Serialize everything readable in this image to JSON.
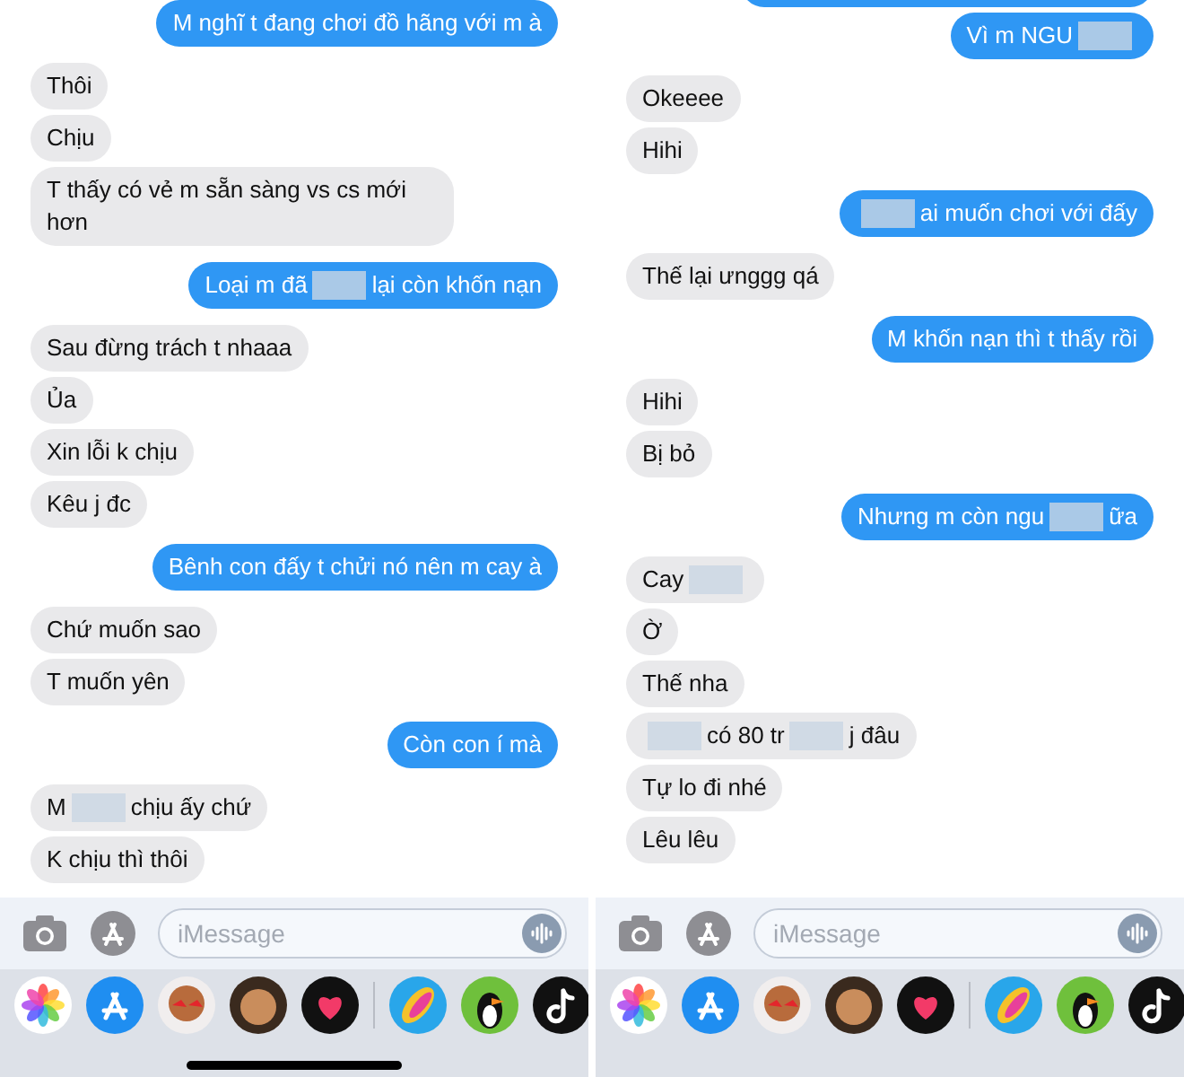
{
  "panels": [
    {
      "messages": [
        {
          "sent": true,
          "kind": "text",
          "parts": [
            {
              "kind": "text",
              "text": "M nghĩ t đang chơi đồ hãng với m à"
            }
          ]
        },
        {
          "sent": false,
          "kind": "text",
          "parts": [
            {
              "kind": "text",
              "text": "Thôi"
            }
          ]
        },
        {
          "sent": false,
          "kind": "text",
          "parts": [
            {
              "kind": "text",
              "text": "Chịu"
            }
          ]
        },
        {
          "sent": false,
          "kind": "text",
          "parts": [
            {
              "kind": "text",
              "text": "T thấy có vẻ m sẵn sàng vs cs mới hơn"
            }
          ]
        },
        {
          "sent": true,
          "kind": "text",
          "parts": [
            {
              "kind": "text",
              "text": "Loại m đã"
            },
            {
              "kind": "blur"
            },
            {
              "kind": "text",
              "text": "lại còn khốn nạn"
            }
          ]
        },
        {
          "sent": false,
          "kind": "text",
          "parts": [
            {
              "kind": "text",
              "text": "Sau đừng trách t nhaaa"
            }
          ]
        },
        {
          "sent": false,
          "kind": "text",
          "parts": [
            {
              "kind": "text",
              "text": "Ủa"
            }
          ]
        },
        {
          "sent": false,
          "kind": "text",
          "parts": [
            {
              "kind": "text",
              "text": "Xin lỗi k chịu"
            }
          ]
        },
        {
          "sent": false,
          "kind": "text",
          "parts": [
            {
              "kind": "text",
              "text": "Kêu j đc"
            }
          ]
        },
        {
          "sent": true,
          "kind": "text",
          "parts": [
            {
              "kind": "text",
              "text": "Bênh con đấy t chửi nó nên m cay à"
            }
          ]
        },
        {
          "sent": false,
          "kind": "text",
          "parts": [
            {
              "kind": "text",
              "text": "Chứ muốn sao"
            }
          ]
        },
        {
          "sent": false,
          "kind": "text",
          "parts": [
            {
              "kind": "text",
              "text": "T muốn yên"
            }
          ]
        },
        {
          "sent": true,
          "kind": "text",
          "parts": [
            {
              "kind": "text",
              "text": "Còn con í mà"
            }
          ]
        },
        {
          "sent": false,
          "kind": "text",
          "parts": [
            {
              "kind": "text",
              "text": "M"
            },
            {
              "kind": "blur"
            },
            {
              "kind": "text",
              "text": "chịu ấy chứ"
            }
          ]
        },
        {
          "sent": false,
          "kind": "text",
          "parts": [
            {
              "kind": "text",
              "text": "K chịu thì thôi"
            }
          ]
        }
      ],
      "input": {
        "placeholder": "iMessage"
      },
      "home_indicator": true
    },
    {
      "messages": [
        {
          "sent": true,
          "kind": "covered"
        },
        {
          "sent": true,
          "kind": "text",
          "parts": [
            {
              "kind": "text",
              "text": "Vì m NGU"
            },
            {
              "kind": "blur"
            }
          ]
        },
        {
          "sent": false,
          "kind": "text",
          "parts": [
            {
              "kind": "text",
              "text": "Okeeee"
            }
          ]
        },
        {
          "sent": false,
          "kind": "text",
          "parts": [
            {
              "kind": "text",
              "text": "Hihi"
            }
          ]
        },
        {
          "sent": true,
          "kind": "text",
          "parts": [
            {
              "kind": "blur"
            },
            {
              "kind": "text",
              "text": "ai muốn chơi với đấy"
            }
          ]
        },
        {
          "sent": false,
          "kind": "text",
          "parts": [
            {
              "kind": "text",
              "text": "Thế lại ưnggg qá"
            }
          ]
        },
        {
          "sent": true,
          "kind": "text",
          "parts": [
            {
              "kind": "text",
              "text": "M khốn nạn thì t thấy rồi"
            }
          ]
        },
        {
          "sent": false,
          "kind": "text",
          "parts": [
            {
              "kind": "text",
              "text": "Hihi"
            }
          ]
        },
        {
          "sent": false,
          "kind": "text",
          "parts": [
            {
              "kind": "text",
              "text": "Bị bỏ"
            }
          ]
        },
        {
          "sent": true,
          "kind": "text",
          "parts": [
            {
              "kind": "text",
              "text": "Nhưng m còn ngu"
            },
            {
              "kind": "blur"
            },
            {
              "kind": "text",
              "text": "ữa"
            }
          ]
        },
        {
          "sent": false,
          "kind": "text",
          "parts": [
            {
              "kind": "text",
              "text": "Cay"
            },
            {
              "kind": "blur"
            }
          ]
        },
        {
          "sent": false,
          "kind": "text",
          "parts": [
            {
              "kind": "text",
              "text": "Ờ"
            }
          ]
        },
        {
          "sent": false,
          "kind": "text",
          "parts": [
            {
              "kind": "text",
              "text": "Thế nha"
            }
          ]
        },
        {
          "sent": false,
          "kind": "text",
          "parts": [
            {
              "kind": "blur"
            },
            {
              "kind": "text",
              "text": "có 80 tr"
            },
            {
              "kind": "blur"
            },
            {
              "kind": "text",
              "text": "j đâu"
            }
          ]
        },
        {
          "sent": false,
          "kind": "text",
          "parts": [
            {
              "kind": "text",
              "text": "Tự lo đi nhé"
            }
          ]
        },
        {
          "sent": false,
          "kind": "text",
          "parts": [
            {
              "kind": "text",
              "text": "Lêu lêu"
            }
          ]
        }
      ],
      "input": {
        "placeholder": "iMessage"
      },
      "home_indicator": false
    }
  ]
}
